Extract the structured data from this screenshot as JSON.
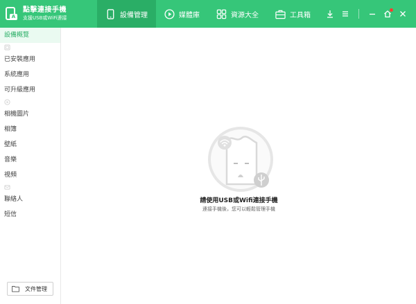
{
  "app": {
    "title": "點擊連接手機",
    "subtitle": "支援USB或WiFi連接",
    "logo_badge": "A"
  },
  "nav": {
    "tabs": [
      {
        "label": "設備管理",
        "icon": "phone-icon",
        "active": true
      },
      {
        "label": "媒體庫",
        "icon": "play-circle-icon",
        "active": false
      },
      {
        "label": "資源大全",
        "icon": "grid-icon",
        "active": false
      },
      {
        "label": "工具箱",
        "icon": "toolbox-icon",
        "active": false
      }
    ]
  },
  "window_controls": [
    "download-icon",
    "menu-icon",
    "minimize-icon",
    "home-icon",
    "close-icon"
  ],
  "sidebar": {
    "overview": "設備概覽",
    "apps_section": [
      "已安裝應用",
      "系統應用",
      "可升級應用"
    ],
    "media_section": [
      "相機圖片",
      "相簿",
      "壁紙",
      "音樂",
      "視頻"
    ],
    "contacts_section": [
      "聯絡人",
      "短信"
    ],
    "file_manager": "文件管理"
  },
  "main": {
    "headline": "請使用USB或Wifi連接手機",
    "hint": "連接手機後，您可以輕鬆管理手機"
  },
  "colors": {
    "brand": "#36c679",
    "brand_active": "#2aae66",
    "notify_dot": "#ff3b30"
  }
}
